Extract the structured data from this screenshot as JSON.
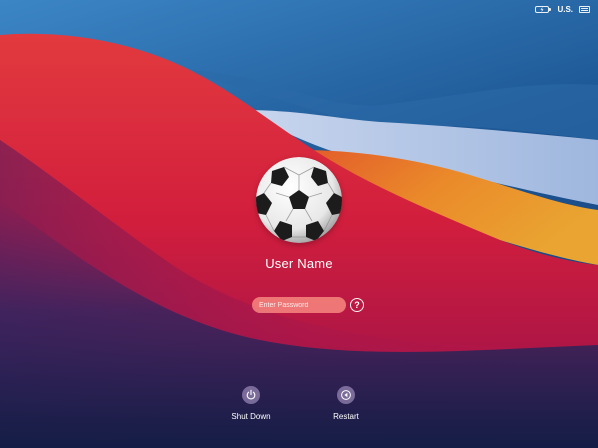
{
  "status_bar": {
    "battery_icon": "battery-charging-icon",
    "input_source": "U.S.",
    "keyboard_icon": "keyboard-icon"
  },
  "login": {
    "avatar_icon": "soccer-ball-avatar",
    "user_name": "User Name",
    "password_placeholder": "Enter Password",
    "hint_icon": "question-mark-icon",
    "hint_glyph": "?"
  },
  "actions": {
    "shutdown_label": "Shut Down",
    "shutdown_icon": "power-icon",
    "restart_label": "Restart",
    "restart_icon": "restart-icon"
  },
  "colors": {
    "sky_blue": "#1c4f86",
    "red_wave": "#d8213a",
    "orange_wave": "#e8892a",
    "deep_navy": "#1b2350"
  }
}
